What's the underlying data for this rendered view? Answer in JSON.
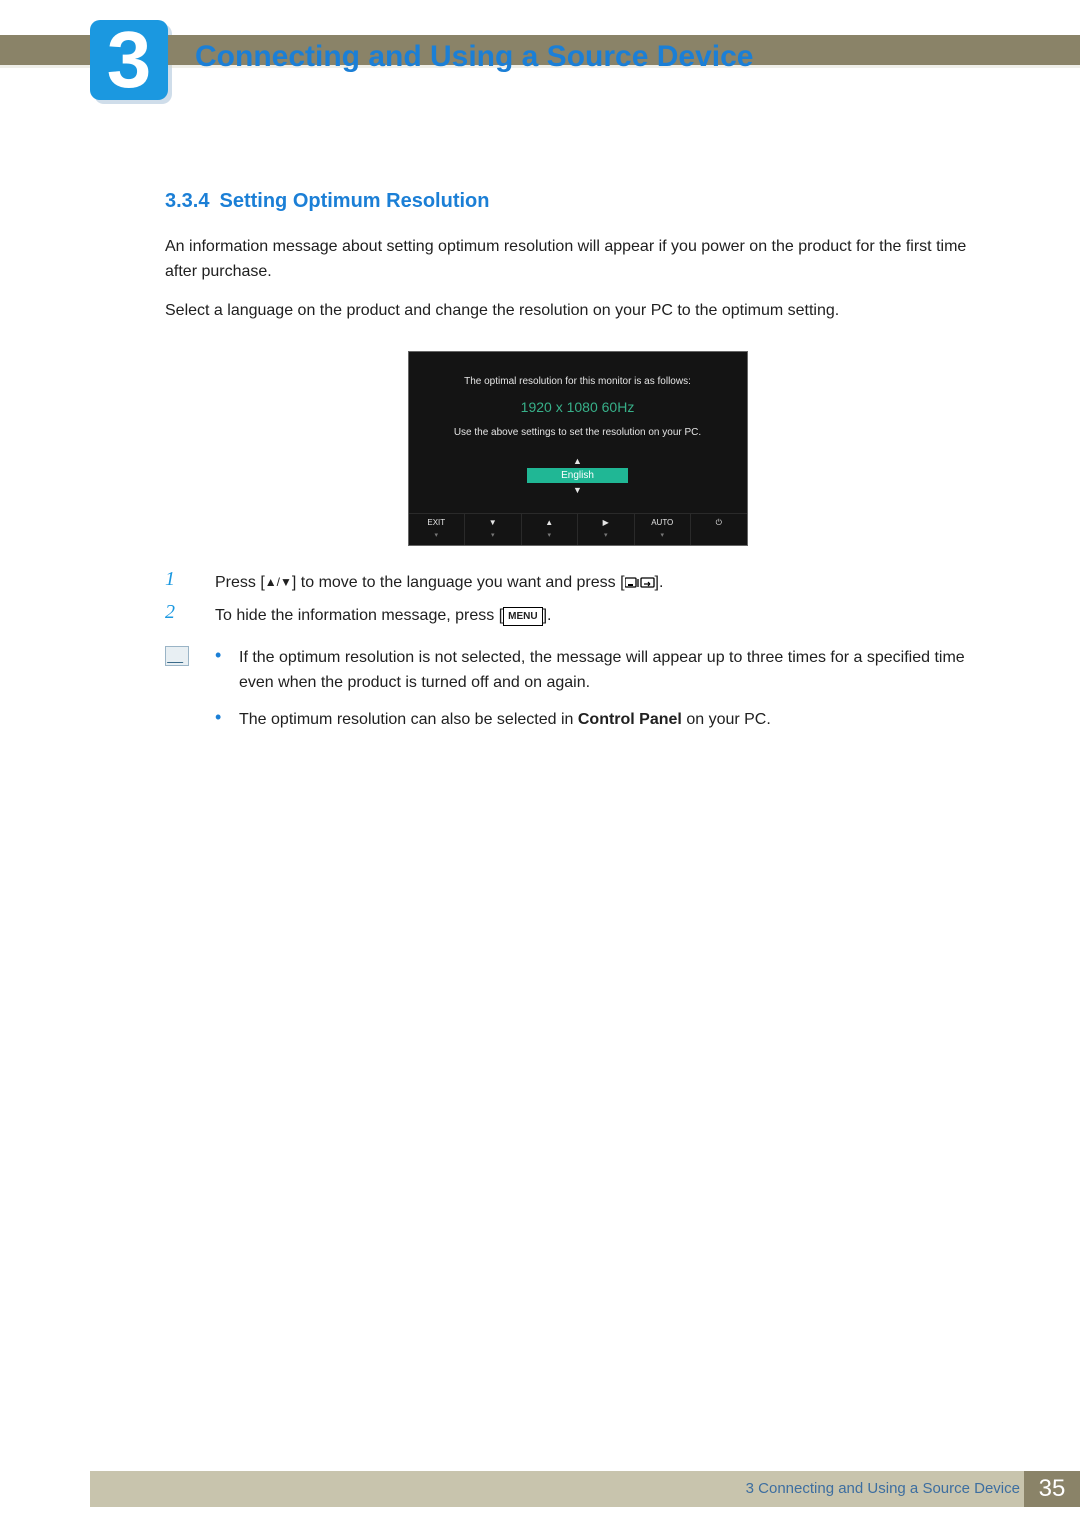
{
  "header": {
    "chapter_number": "3",
    "chapter_title": "Connecting and Using a Source Device"
  },
  "section": {
    "number": "3.3.4",
    "title": "Setting Optimum Resolution"
  },
  "intro_para_1": "An information message about setting optimum resolution will appear if you power on the product for the first time after purchase.",
  "intro_para_2": "Select a language on the product and change the resolution on your PC to the optimum setting.",
  "osd": {
    "line1": "The optimal resolution for this monitor is as follows:",
    "resolution": "1920 x 1080  60Hz",
    "line2": "Use the above settings to set the resolution on your PC.",
    "language": "English",
    "buttons": {
      "exit": "EXIT",
      "auto": "AUTO",
      "down_arrow": "▼",
      "up_arrow": "▲",
      "right_arrow": "▶",
      "power": "⏻",
      "under_arrow": "▾"
    }
  },
  "steps": [
    {
      "num": "1",
      "pre": "Press [",
      "mid": "] to move to the language you want and press [",
      "post": "]."
    },
    {
      "num": "2",
      "pre": "To hide the information message, press [",
      "menu_label": "MENU",
      "post": "]."
    }
  ],
  "notes": [
    {
      "text_a": "If the optimum resolution is not selected, the message will appear up to three times for a specified time even when the product is turned off and on again."
    },
    {
      "text_a": "The optimum resolution can also be selected in ",
      "bold": "Control Panel",
      "text_b": " on your PC."
    }
  ],
  "footer": {
    "text": "3 Connecting and Using a Source Device",
    "page": "35"
  }
}
